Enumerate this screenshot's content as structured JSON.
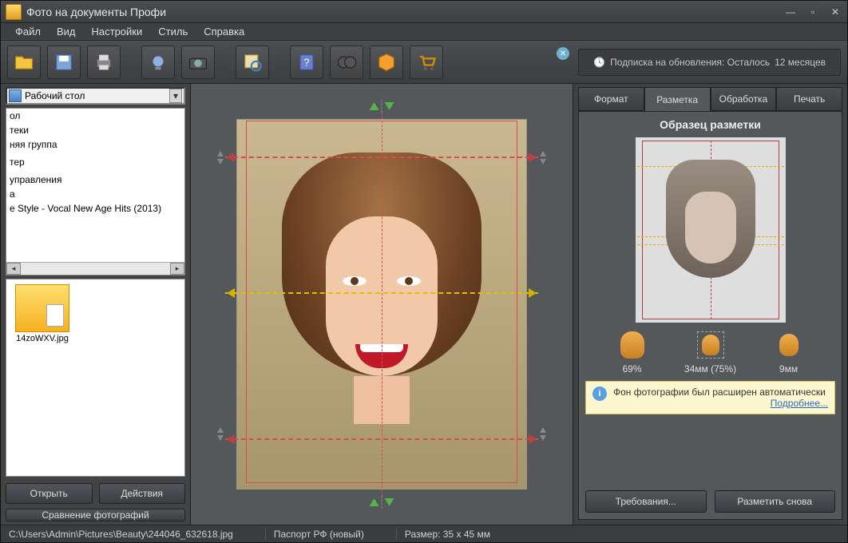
{
  "window": {
    "title": "Фото на документы Профи"
  },
  "menu": [
    "Файл",
    "Вид",
    "Настройки",
    "Стиль",
    "Справка"
  ],
  "subscription": {
    "label": "Подписка на обновления: Осталось",
    "months": "12 месяцев"
  },
  "left": {
    "folder_selected": "Рабочий стол",
    "folders": [
      "ол",
      "теки",
      "няя группа",
      "",
      "тер",
      "",
      "управления",
      "а",
      "e Style - Vocal New Age Hits (2013)"
    ],
    "thumb_name": "14zoWXV.jpg",
    "open": "Открыть",
    "actions": "Действия",
    "compare": "Сравнение фотографий"
  },
  "right": {
    "tabs": {
      "format": "Формат",
      "markup": "Разметка",
      "processing": "Обработка",
      "print": "Печать"
    },
    "title": "Образец разметки",
    "metric1": "69%",
    "metric2": "34мм (75%)",
    "metric3": "9мм",
    "info_text": "Фон фотографии был расширен автоматически",
    "info_link": "Подробнее...",
    "reqs": "Требования...",
    "again": "Разметить снова"
  },
  "status": {
    "path": "C:\\Users\\Admin\\Pictures\\Beauty\\244046_632618.jpg",
    "format": "Паспорт РФ (новый)",
    "size": "Размер: 35 x 45 мм"
  }
}
